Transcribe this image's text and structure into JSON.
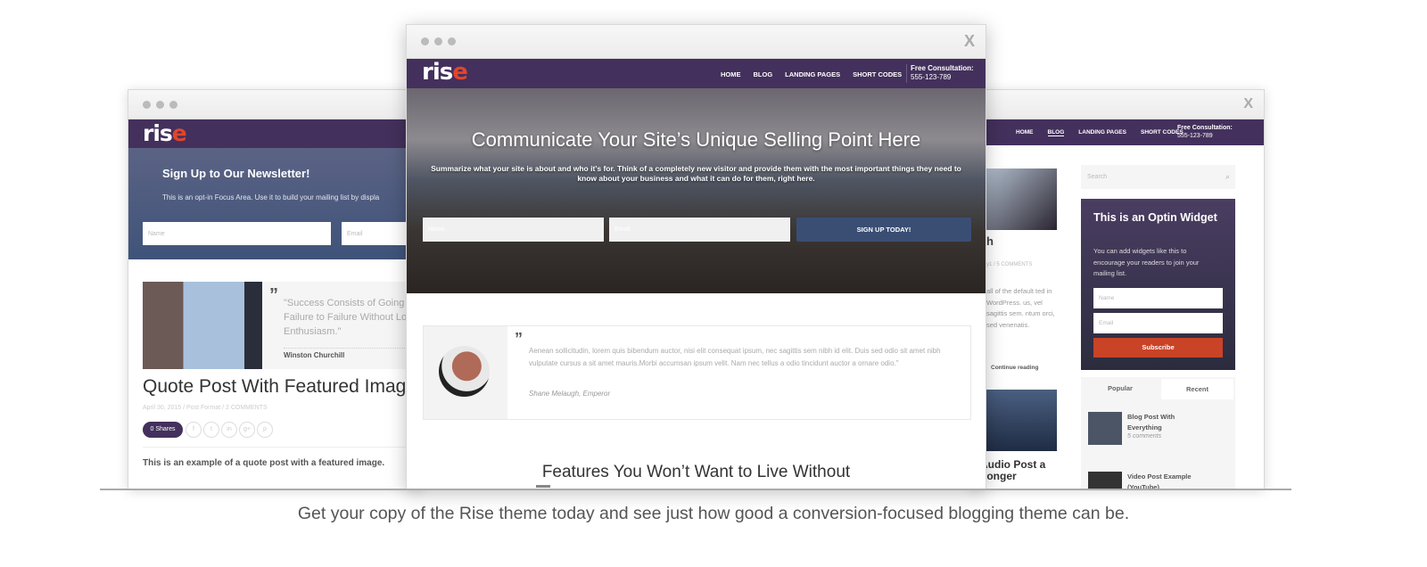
{
  "brand": {
    "logo_text": "ris",
    "logo_accent": "e",
    "purple": "#43305c",
    "accent": "#e2452a",
    "button_blue": "#3a4e74"
  },
  "nav": {
    "items": [
      "HOME",
      "BLOG",
      "LANDING PAGES",
      "SHORT CODES"
    ],
    "consult_label": "Free Consultation:",
    "consult_phone": "555-123-789"
  },
  "window_close": "X",
  "left": {
    "newsletter_title": "Sign Up to Our Newsletter!",
    "newsletter_text": "This is an opt-in Focus Area. Use it to build your mailing list by displa",
    "name_placeholder": "Name",
    "email_placeholder": "Email",
    "quote": "\"Success Consists of Going from Failure to Failure Without Loss of Enthusiasm.\"",
    "quote_author": "Winston Churchill",
    "post_title": "Quote Post With Featured Image",
    "post_meta": "April 30, 2015 / Post Format / 2 COMMENTS",
    "shares": "0 Shares",
    "share_icons": [
      "f",
      "t",
      "in",
      "g+",
      "p"
    ],
    "excerpt": "This is an example of a quote post with a featured image."
  },
  "center": {
    "hero_title": "Communicate Your Site’s Unique Selling Point Here",
    "hero_text": "Summarize what your site is about and who it’s for. Think of a completely new visitor and provide them with the most important things they need to know about your business and what it can do for them, right here.",
    "name_placeholder": "Name",
    "email_placeholder": "Email",
    "signup_button": "SIGN UP TODAY!",
    "testimonial_text": "Aenean sollicitudin, lorem quis bibendum auctor, nisi elit consequat ipsum, nec sagittis sem nibh id elit. Duis sed odio sit amet nibh vulputate cursus a sit amet mauris.Morbi accumsan ipsum velit. Nam nec tellus a odio tincidunt auctor a ornare odio.\"",
    "testimonial_author": "Shane Melaugh,  Emperor",
    "features_title": "Features You Won’t Want to Live Without"
  },
  "right": {
    "post_title_fragment": "h",
    "post_meta_fragment": "y1 / 5 COMMENTS",
    "excerpt_fragment": "all of the default ted in WordPress. us, vel sagittis sem. ntum orci, sed venenatis.",
    "continue_reading": "Continue reading",
    "audio_post_fragment": "Audio Post a Longer",
    "search_placeholder": "Search",
    "optin_title": "This is an Optin Widget",
    "optin_text": "You can add widgets like this to encourage your readers to join your mailing list.",
    "name_placeholder": "Name",
    "email_placeholder": "Email",
    "subscribe": "Subscribe",
    "tabs": [
      "Popular",
      "Recent"
    ],
    "posts": [
      {
        "title": "Blog Post With Everything",
        "meta": "5 comments"
      },
      {
        "title": "Video Post Example (YouTube)",
        "meta": ""
      }
    ]
  },
  "caption": "Get your copy of the Rise theme today and see just how good a conversion-focused blogging theme can be."
}
